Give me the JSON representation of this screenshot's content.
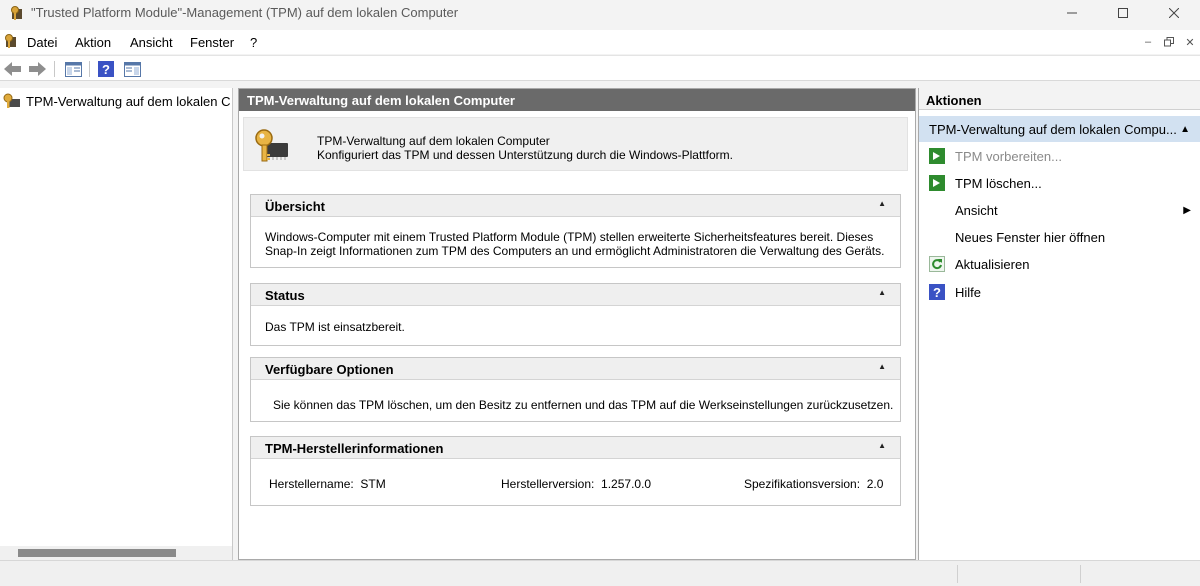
{
  "window": {
    "title": "\"Trusted Platform Module\"-Management (TPM) auf dem lokalen Computer",
    "minimize": "—",
    "maximize": "☐",
    "close": "✕"
  },
  "menu": {
    "items": [
      "Datei",
      "Aktion",
      "Ansicht",
      "Fenster",
      "?"
    ],
    "mdi": {
      "minimize": "–",
      "restore": "🗗",
      "close": "✕"
    }
  },
  "toolbar": {
    "buttons": [
      "back-arrow-icon",
      "forward-arrow-icon",
      "console-tree-icon",
      "help-icon",
      "action-pane-icon"
    ]
  },
  "tree": {
    "root_label": "TPM-Verwaltung auf dem lokalen C"
  },
  "center": {
    "header": "TPM-Verwaltung auf dem lokalen Computer",
    "intro_title": "TPM-Verwaltung auf dem lokalen Computer",
    "intro_desc": "Konfiguriert das TPM und dessen Unterstützung durch die Windows-Plattform.",
    "sections": {
      "overview": {
        "title": "Übersicht",
        "line1": "Windows-Computer mit einem Trusted Platform Module (TPM) stellen erweiterte Sicherheitsfeatures bereit. Dieses",
        "line2": "Snap-In zeigt Informationen zum TPM des Computers an und ermöglicht Administratoren die Verwaltung des Geräts."
      },
      "status": {
        "title": "Status",
        "text": "Das TPM ist einsatzbereit."
      },
      "options": {
        "title": "Verfügbare Optionen",
        "text": "Sie können das TPM löschen, um den Besitz zu entfernen und das TPM auf die Werkseinstellungen zurückzusetzen."
      },
      "vendor": {
        "title": "TPM-Herstellerinformationen",
        "manufacturer_label": "Herstellername:",
        "manufacturer_value": "STM",
        "version_label": "Herstellerversion:",
        "version_value": "1.257.0.0",
        "spec_label": "Spezifikationsversion:",
        "spec_value": "2.0"
      }
    },
    "collapse_glyph": "▲"
  },
  "actions": {
    "title": "Aktionen",
    "group": "TPM-Verwaltung auf dem lokalen Compu...",
    "items": [
      {
        "label": "TPM vorbereiten...",
        "icon": "green-run-icon",
        "disabled": true
      },
      {
        "label": "TPM löschen...",
        "icon": "green-run-icon",
        "disabled": false
      },
      {
        "label": "Ansicht",
        "icon": "",
        "submenu": true
      },
      {
        "label": "Neues Fenster hier öffnen",
        "icon": ""
      },
      {
        "label": "Aktualisieren",
        "icon": "refresh-icon"
      },
      {
        "label": "Hilfe",
        "icon": "help-icon"
      }
    ],
    "submenu_glyph": "▶",
    "collapse_glyph": "▲"
  },
  "colors": {
    "header_bg": "#6a6a6a",
    "action_group_bg": "#d2e1f1",
    "run_icon_green": "#2e8b2e",
    "help_icon_blue": "#3a52c4"
  }
}
